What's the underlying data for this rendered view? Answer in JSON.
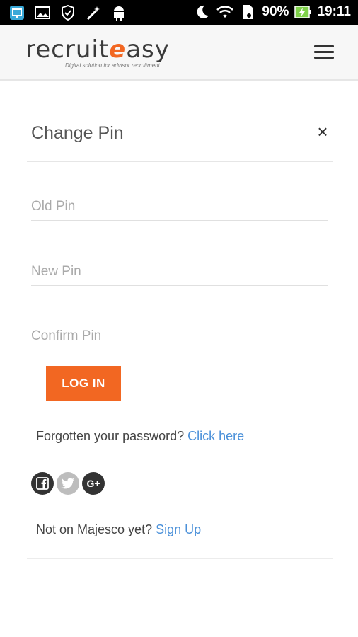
{
  "status_bar": {
    "battery": "90%",
    "time": "19:11",
    "icons": [
      "screen-cast-icon",
      "image-icon",
      "shield-icon",
      "magic-wand-icon",
      "android-icon",
      "moon-icon",
      "wifi-icon",
      "sim-icon",
      "battery-charging-icon"
    ]
  },
  "header": {
    "logo_main": "recruit",
    "logo_accent": "e",
    "logo_rest": "asy",
    "logo_tagline": "Digital solution for advisor recruitment.",
    "menu_icon": "hamburger-menu-icon"
  },
  "modal": {
    "title": "Change Pin",
    "close_label": "×",
    "fields": {
      "old_pin_placeholder": "Old Pin",
      "new_pin_placeholder": "New Pin",
      "confirm_pin_placeholder": "Confirm Pin"
    },
    "login_label": "LOG IN",
    "forgot_text": "Forgotten your password? ",
    "forgot_link": "Click here",
    "social": [
      "facebook-icon",
      "twitter-icon",
      "google-plus-icon"
    ],
    "google_plus_label": "G+",
    "signup_text": "Not on Majesco yet? ",
    "signup_link": "Sign Up"
  },
  "colors": {
    "accent": "#f26722",
    "link": "#4a90d9",
    "status_bar": "#000000",
    "header_bg": "#f7f7f7"
  }
}
